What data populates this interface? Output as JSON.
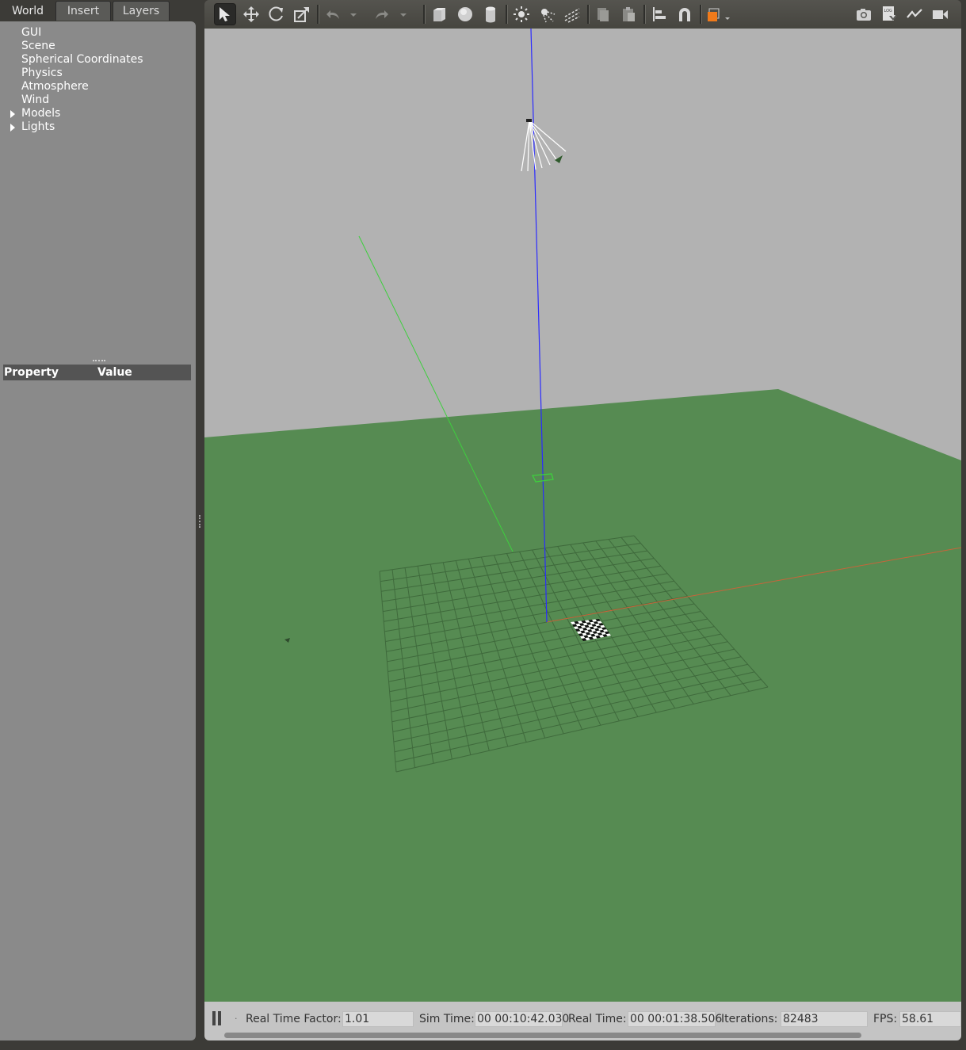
{
  "tabs": [
    {
      "label": "World",
      "active": true
    },
    {
      "label": "Insert",
      "active": false
    },
    {
      "label": "Layers",
      "active": false
    }
  ],
  "world_tree": {
    "items": [
      {
        "label": "GUI",
        "expandable": false
      },
      {
        "label": "Scene",
        "expandable": false
      },
      {
        "label": "Spherical Coordinates",
        "expandable": false
      },
      {
        "label": "Physics",
        "expandable": false
      },
      {
        "label": "Atmosphere",
        "expandable": false
      },
      {
        "label": "Wind",
        "expandable": false
      },
      {
        "label": "Models",
        "expandable": true
      },
      {
        "label": "Lights",
        "expandable": true
      }
    ]
  },
  "properties": {
    "col_property": "Property",
    "col_value": "Value"
  },
  "toolbar": {
    "tools": [
      "select-arrow-icon",
      "translate-icon",
      "rotate-icon",
      "scale-icon",
      "undo-icon",
      "undo-history-icon",
      "redo-icon",
      "redo-history-icon",
      "box-icon",
      "sphere-icon",
      "cylinder-icon",
      "point-light-icon",
      "spot-light-icon",
      "directional-light-icon",
      "copy-icon",
      "paste-icon",
      "align-icon",
      "snap-icon",
      "view-angle-icon",
      "screenshot-icon",
      "log-icon",
      "plot-icon",
      "record-video-icon"
    ]
  },
  "status": {
    "rtf_label": "Real Time Factor:",
    "rtf_value": "1.01",
    "sim_label": "Sim Time:",
    "sim_value": "00 00:10:42.030",
    "real_label": "Real Time:",
    "real_value": "00 00:01:38.506",
    "iter_label": "Iterations:",
    "iter_value": "82483",
    "fps_label": "FPS:",
    "fps_value": "58.61",
    "step_label": "."
  },
  "colors": {
    "sky": "#b2b2b2",
    "ground": "#568b52",
    "axis_z": "#2b2bff",
    "axis_y": "#3ecf3e",
    "axis_x": "#c8643a",
    "accent_orange": "#f07a1a"
  }
}
